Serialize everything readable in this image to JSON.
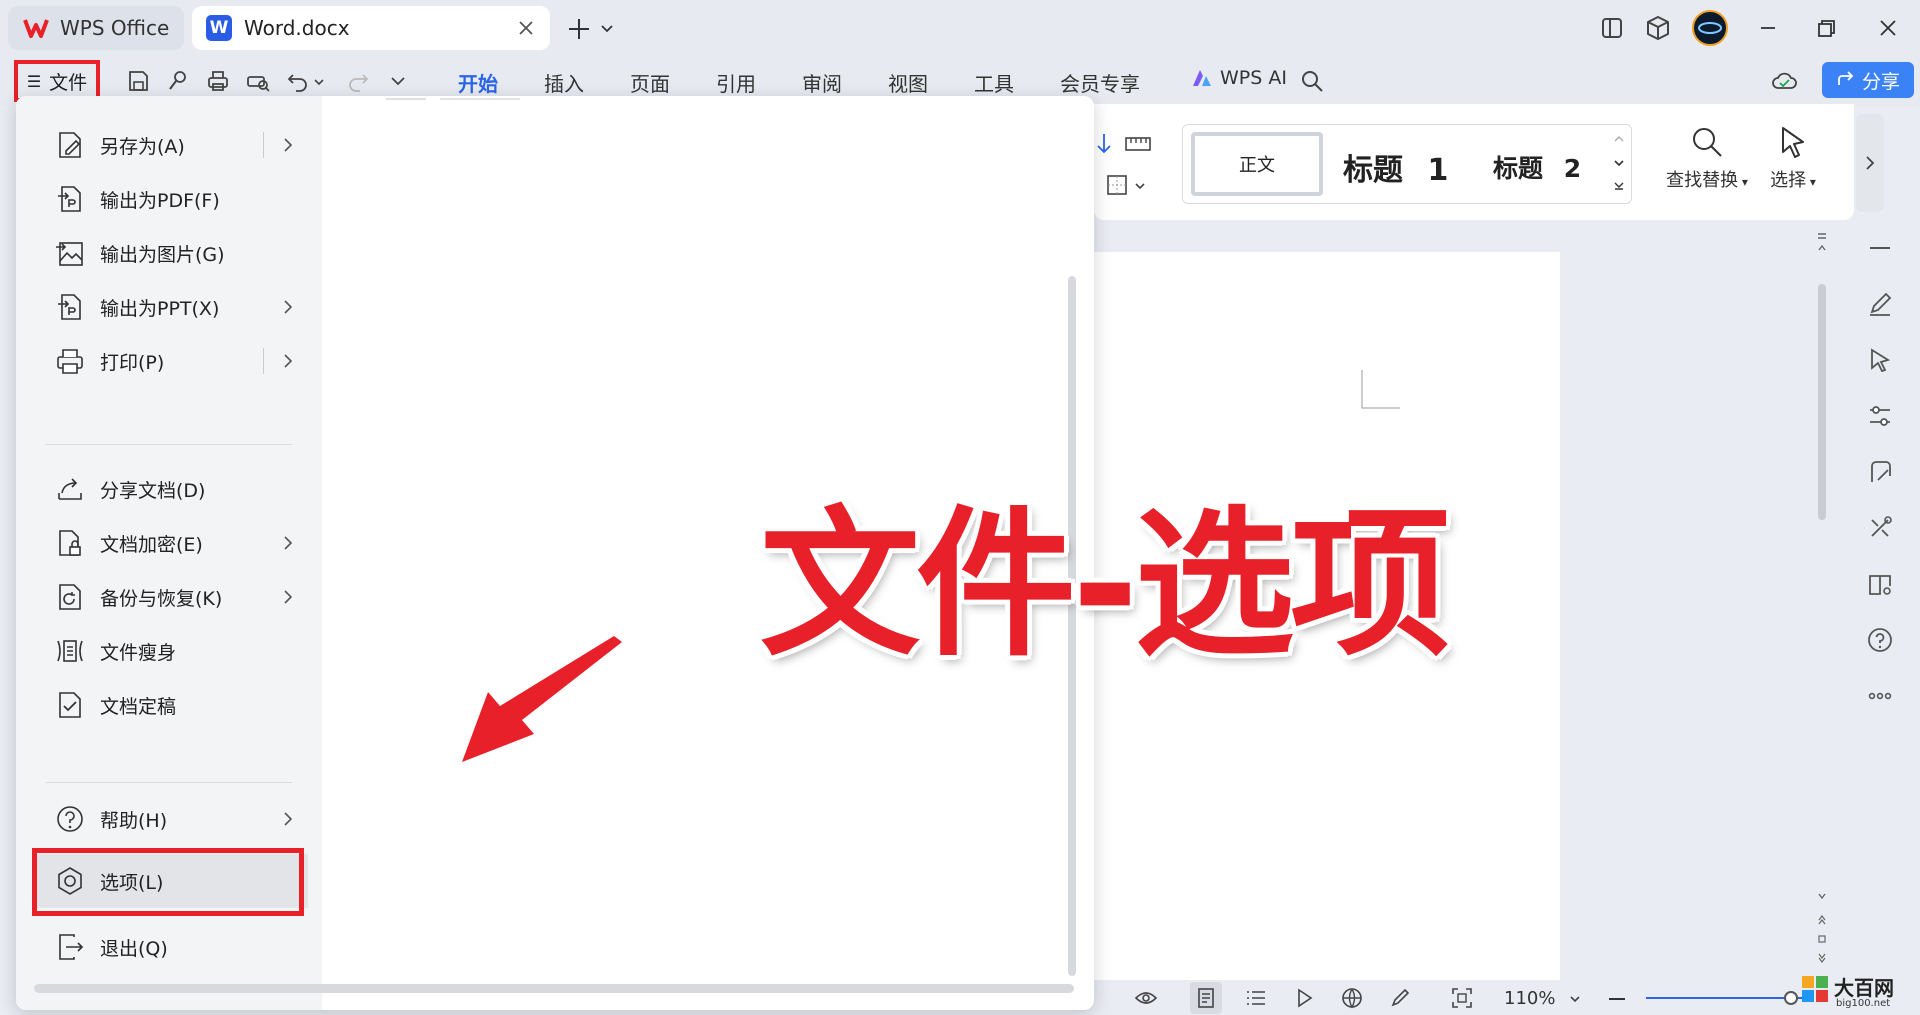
{
  "tabs": [
    {
      "label": "WPS Office"
    },
    {
      "label": "Word.docx"
    }
  ],
  "file_button": {
    "label": "文件",
    "menu_glyph": "☰"
  },
  "menu_tabs": [
    "开始",
    "插入",
    "页面",
    "引用",
    "审阅",
    "视图",
    "工具",
    "会员专享"
  ],
  "wps_ai": {
    "label": "WPS AI"
  },
  "share": {
    "label": "分享"
  },
  "styles": {
    "normal": "正文",
    "h1": "标题",
    "h1_num": "1",
    "h2": "标题",
    "h2_num": "2"
  },
  "tools": {
    "find_replace": "查找替换",
    "select": "选择"
  },
  "file_menu": {
    "items": [
      {
        "label": "另存为(A)",
        "icon": "save-as-icon",
        "submenu": true
      },
      {
        "label": "输出为PDF(F)",
        "icon": "export-pdf-icon",
        "submenu": false
      },
      {
        "label": "输出为图片(G)",
        "icon": "export-image-icon",
        "submenu": false
      },
      {
        "label": "输出为PPT(X)",
        "icon": "export-ppt-icon",
        "submenu": true
      },
      {
        "label": "打印(P)",
        "icon": "print-icon",
        "submenu": true
      },
      {
        "label": "分享文档(D)",
        "icon": "share-icon",
        "submenu": false
      },
      {
        "label": "文档加密(E)",
        "icon": "encrypt-icon",
        "submenu": true
      },
      {
        "label": "备份与恢复(K)",
        "icon": "backup-icon",
        "submenu": true
      },
      {
        "label": "文件瘦身",
        "icon": "slim-icon",
        "submenu": false
      },
      {
        "label": "文档定稿",
        "icon": "finalize-icon",
        "submenu": false
      },
      {
        "label": "帮助(H)",
        "icon": "help-icon",
        "submenu": true
      },
      {
        "label": "选项(L)",
        "icon": "options-gear-icon",
        "submenu": false
      },
      {
        "label": "退出(Q)",
        "icon": "exit-icon",
        "submenu": false
      }
    ]
  },
  "annotation": {
    "text": "文件-选项"
  },
  "status": {
    "zoom": "110%"
  },
  "watermark": {
    "name": "大百网",
    "url": "big100.net"
  },
  "colors": {
    "accent": "#2a64e8",
    "highlight": "#e8202a",
    "share_bg": "#3b82f6"
  }
}
